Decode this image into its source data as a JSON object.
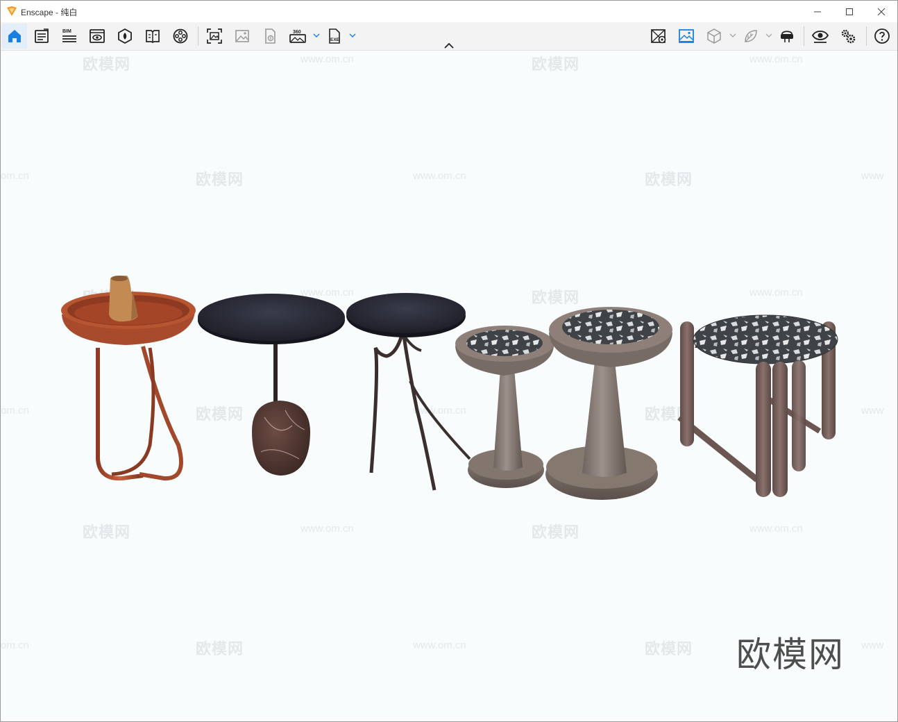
{
  "window": {
    "title": "Enscape - 纯白",
    "minimize_icon": "minimize-icon",
    "maximize_icon": "maximize-icon",
    "close_icon": "close-icon"
  },
  "toolbar": {
    "bim_label": "BIM",
    "panorama_label": "360",
    "exe_label": "EXE",
    "left_icons": [
      "home-icon",
      "view-management-icon",
      "bim-icon",
      "visual-settings-icon",
      "asset-library-icon",
      "material-editor-icon",
      "video-editor-icon",
      "screenshot-icon",
      "batch-render-icon",
      "upload-icon",
      "panorama-icon",
      "exe-export-icon"
    ],
    "right_icons": [
      "sync-views-icon",
      "sync-update-icon",
      "orthographic-icon",
      "light-view-icon",
      "vr-headset-icon",
      "view-options-icon",
      "settings-icon",
      "help-icon"
    ],
    "accent": "#1a7fe0"
  },
  "viewport": {
    "watermark_text": "欧模网",
    "watermark_url": "www.om.cn",
    "watermark_url_cut": "om.cn",
    "watermark_url_cut_right": "www",
    "brand_watermark": "欧模网",
    "background": "#f8fcfd"
  }
}
